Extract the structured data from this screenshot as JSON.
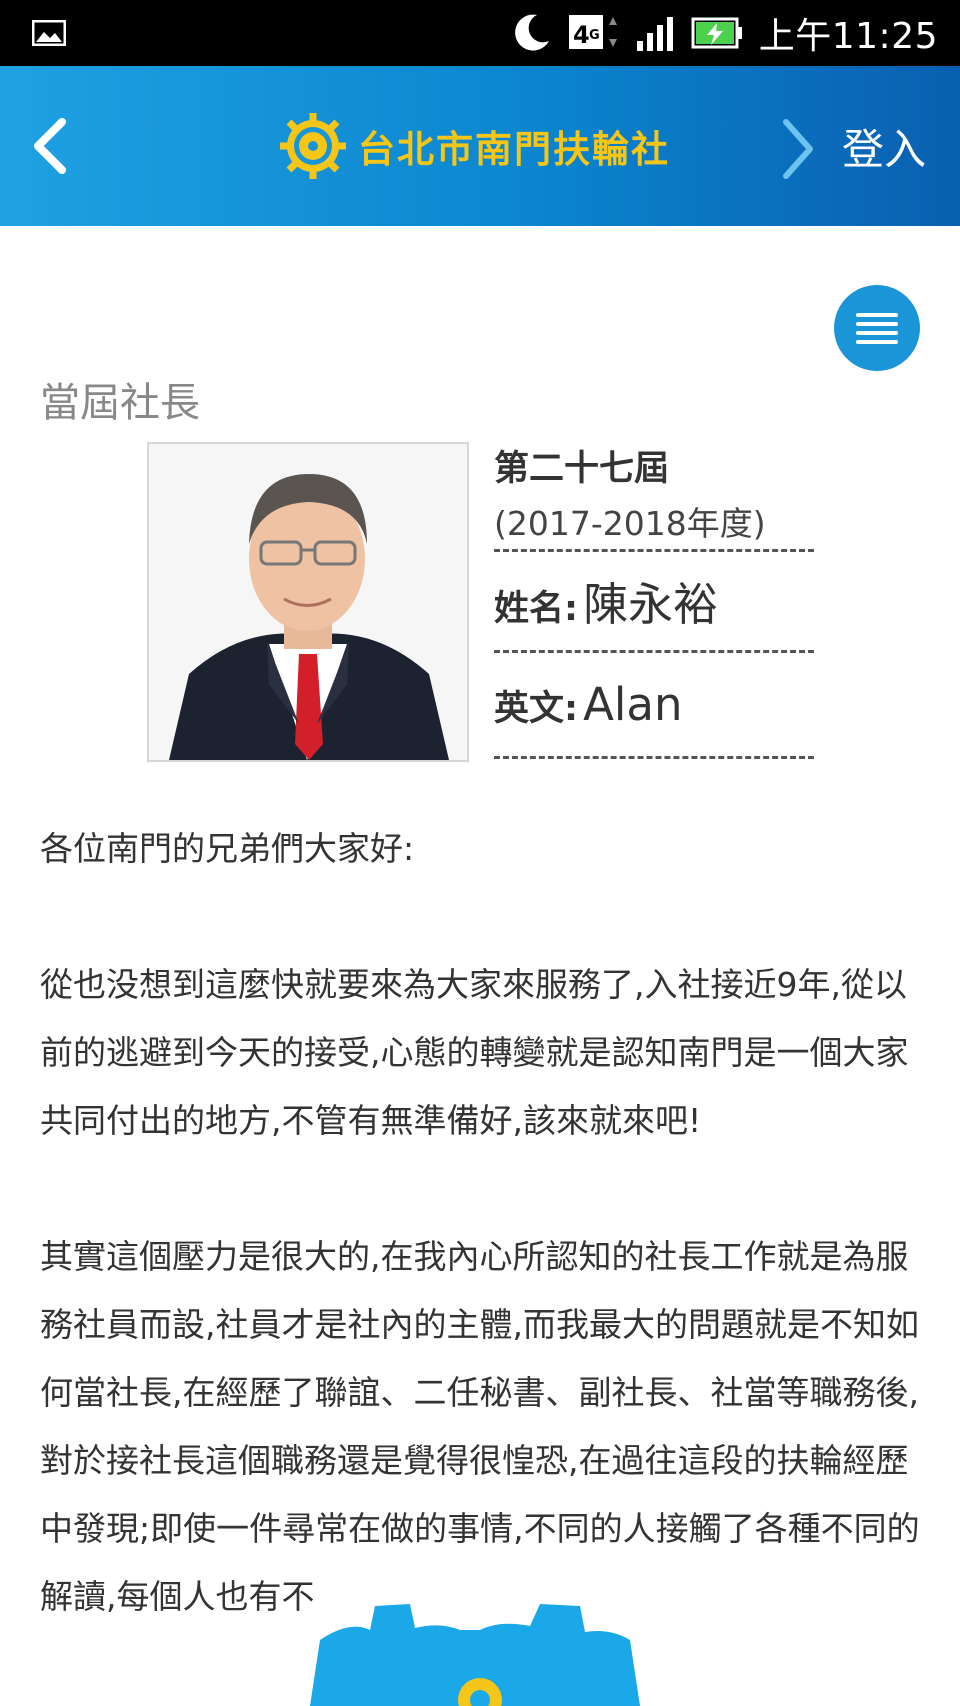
{
  "status_bar": {
    "time": "上午11:25",
    "network": "4G",
    "icons": [
      "gallery-icon",
      "moon-icon",
      "network-4g-icon",
      "signal-icon",
      "battery-charging-icon"
    ]
  },
  "header": {
    "title": "台北市南門扶輪社",
    "login_label": "登入",
    "logo": "rotary-wheel-logo"
  },
  "section_title": "當屆社長",
  "profile": {
    "term": "第二十七屆",
    "year": "(2017-2018年度)",
    "name_label": "姓名:",
    "name_value": "陳永裕",
    "english_label": "英文:",
    "english_value": "Alan"
  },
  "content": {
    "greeting": "各位南門的兄弟們大家好:",
    "paragraph1": "從也没想到這麼快就要來為大家來服務了,入社接近9年,從以前的逃避到今天的接受,心態的轉變就是認知南門是一個大家共同付出的地方,不管有無準備好,該來就來吧!",
    "paragraph2": "其實這個壓力是很大的,在我內心所認知的社長工作就是為服務社員而設,社員才是社內的主體,而我最大的問題就是不知如何當社長,在經歷了聯誼、二任秘書、副社長、社當等職務後,對於接社長這個職務還是覺得很惶恐,在過往這段的扶輪經歷中發現;即使一件尋常在做的事情,不同的人接觸了各種不同的解讀,每個人也有不"
  },
  "colors": {
    "header_start": "#1fa1e2",
    "header_end": "#0a5fb0",
    "title_gold": "#f5c518",
    "menu_blue": "#1a96d8"
  }
}
